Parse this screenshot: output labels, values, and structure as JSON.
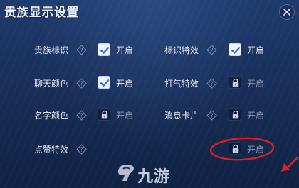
{
  "dialog": {
    "title": "贵族显示设置"
  },
  "settings": [
    {
      "label": "贵族标识",
      "state_label": "开启",
      "state": "checked",
      "help_icon": "question-diamond-icon"
    },
    {
      "label": "标识特效",
      "state_label": "开启",
      "state": "checked",
      "help_icon": "question-diamond-icon"
    },
    {
      "label": "聊天颜色",
      "state_label": "开启",
      "state": "checked",
      "help_icon": "question-diamond-icon"
    },
    {
      "label": "打气特效",
      "state_label": "开启",
      "state": "locked",
      "help_icon": "question-diamond-icon"
    },
    {
      "label": "名字颜色",
      "state_label": "开启",
      "state": "locked",
      "help_icon": "question-diamond-icon"
    },
    {
      "label": "消息卡片",
      "state_label": "开启",
      "state": "locked",
      "help_icon": "question-diamond-icon"
    },
    {
      "label": "点赞特效",
      "state_label": "开启",
      "state": "locked",
      "help_icon": "question-diamond-icon"
    }
  ],
  "watermark": {
    "text": "九游"
  },
  "annotation": {
    "color": "#e11d1d",
    "shape": "ellipse-with-arrow"
  },
  "colors": {
    "panel_top": "#1f3a6c",
    "panel_bottom": "#0f2244",
    "check_fill": "#eef3fb",
    "check_mark": "#2f6fd8",
    "disabled_text": "#8c9ab4"
  },
  "icons": {
    "close": "close-icon",
    "check": "checkmark-icon",
    "lock": "lock-icon",
    "help": "question-diamond-icon"
  }
}
